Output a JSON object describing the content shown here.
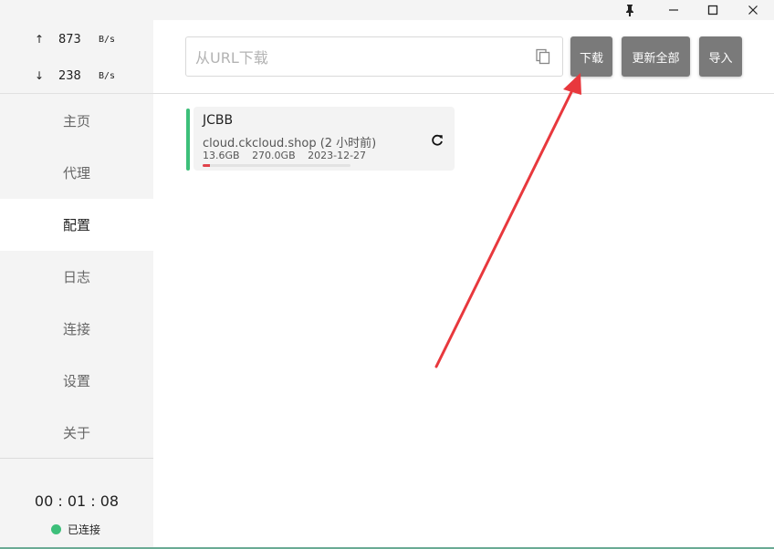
{
  "titlebar": {
    "pin_glyph": "📌"
  },
  "traffic": {
    "up_arrow": "↑",
    "up_value": "873",
    "up_unit": "B/s",
    "down_arrow": "↓",
    "down_value": "238",
    "down_unit": "B/s"
  },
  "nav": {
    "items": [
      {
        "label": "主页"
      },
      {
        "label": "代理"
      },
      {
        "label": "配置"
      },
      {
        "label": "日志"
      },
      {
        "label": "连接"
      },
      {
        "label": "设置"
      },
      {
        "label": "关于"
      }
    ],
    "active_index": 2
  },
  "status": {
    "timer": "00 : 01 : 08",
    "connection": "已连接",
    "connection_color": "#3dbf7a"
  },
  "toolbar": {
    "url_placeholder": "从URL下载",
    "download_label": "下载",
    "update_all_label": "更新全部",
    "import_label": "导入"
  },
  "profile": {
    "name": "JCBB",
    "host": "cloud.ckcloud.shop (2 小时前)",
    "used": "13.6GB",
    "total": "270.0GB",
    "expire": "2023-12-27",
    "usage_fraction": 0.05,
    "accent_color": "#3dbf7a",
    "bar_color": "#e0434b"
  },
  "annotation": {
    "arrow_color": "#e8383d"
  }
}
